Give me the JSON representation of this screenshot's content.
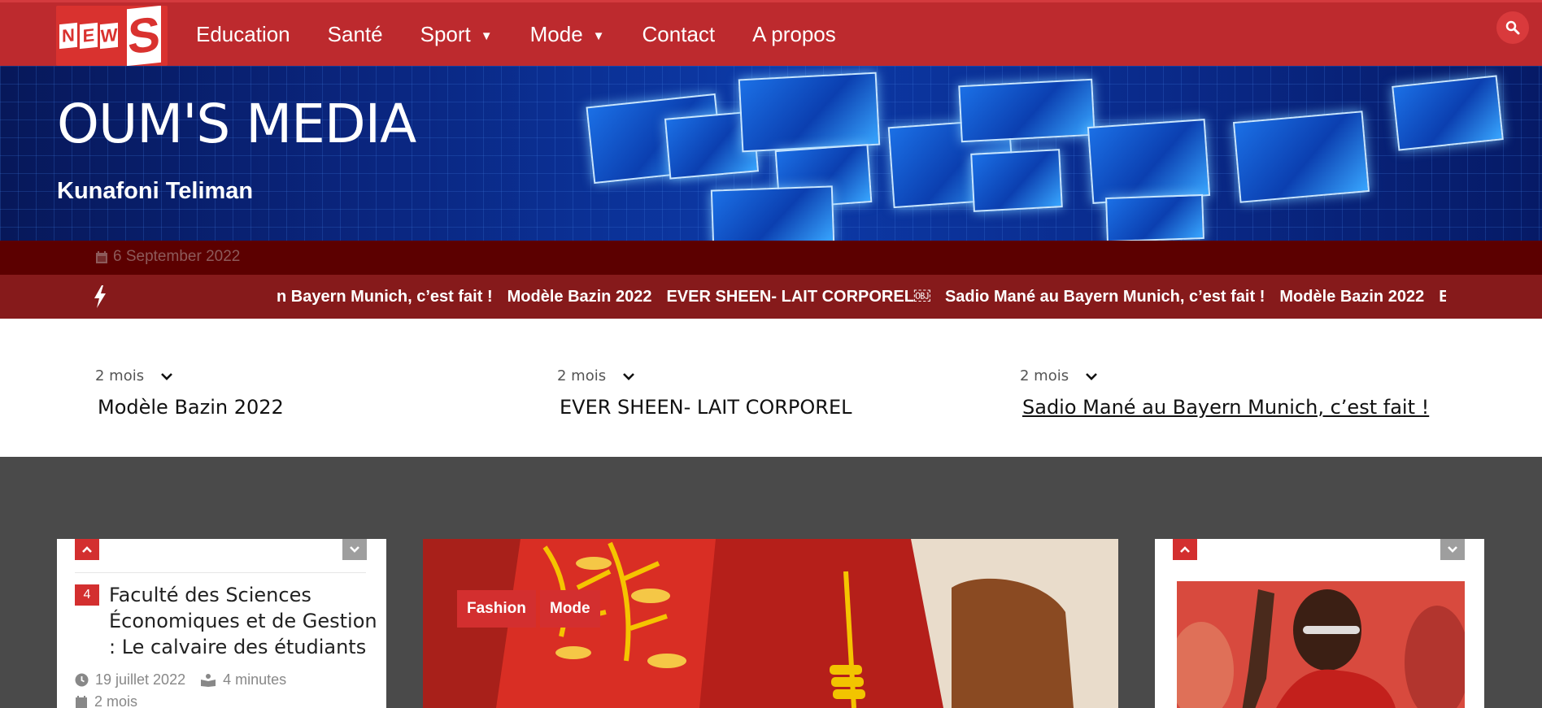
{
  "navbar": {
    "logo_letters": [
      "N",
      "E",
      "W"
    ],
    "logo_big": "S",
    "items": [
      {
        "label": "Education"
      },
      {
        "label": "Santé"
      },
      {
        "label": "Sport",
        "caret": "▼"
      },
      {
        "label": "Mode",
        "caret": "▼"
      },
      {
        "label": "Contact"
      },
      {
        "label": "A propos"
      }
    ]
  },
  "hero": {
    "title": "OUM'S MEDIA",
    "subtitle": "Kunafoni Teliman"
  },
  "datebar": {
    "date": "6 September 2022"
  },
  "ticker": {
    "items": [
      "n Bayern Munich, c’est fait !",
      "Modèle Bazin 2022",
      "EVER SHEEN- LAIT CORPOREL￼",
      "Sadio Mané au Bayern Munich, c’est fait !",
      "Modèle Bazin 2022",
      "EVI"
    ]
  },
  "recent": [
    {
      "age": "2 mois",
      "title": "Modèle Bazin 2022"
    },
    {
      "age": "2 mois",
      "title": "EVER SHEEN- LAIT CORPOREL￼"
    },
    {
      "age": "2 mois",
      "title": "Sadio Mané au Bayern Munich, c’est fait !"
    }
  ],
  "left_card": {
    "rank": "4",
    "title": "Faculté des Sciences Économiques et de Gestion : Le calvaire des étudiants",
    "date": "19 juillet 2022",
    "read_time": "4 minutes",
    "age": "2 mois"
  },
  "mid_card": {
    "tags": [
      "Fashion",
      "Mode"
    ]
  },
  "colors": {
    "navbar": "#bd2a2e",
    "accent_red": "#d32f2f",
    "date_bar": "#5c0000",
    "ticker": "#861a1b",
    "content_bg": "#4a4a4a"
  }
}
